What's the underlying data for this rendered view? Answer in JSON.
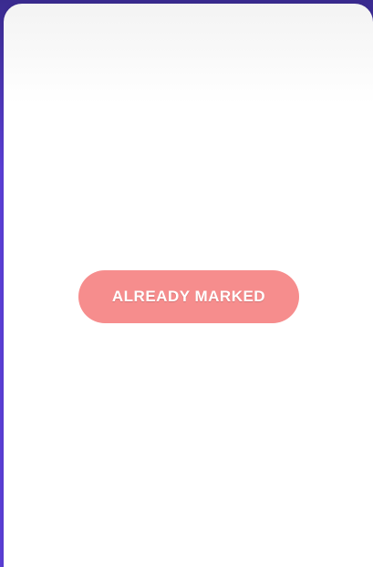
{
  "status_button": {
    "label": "ALREADY MARKED"
  },
  "colors": {
    "background": "#5b3fd6",
    "card": "#ffffff",
    "button": "#f68d8d",
    "button_text": "#ffffff"
  }
}
